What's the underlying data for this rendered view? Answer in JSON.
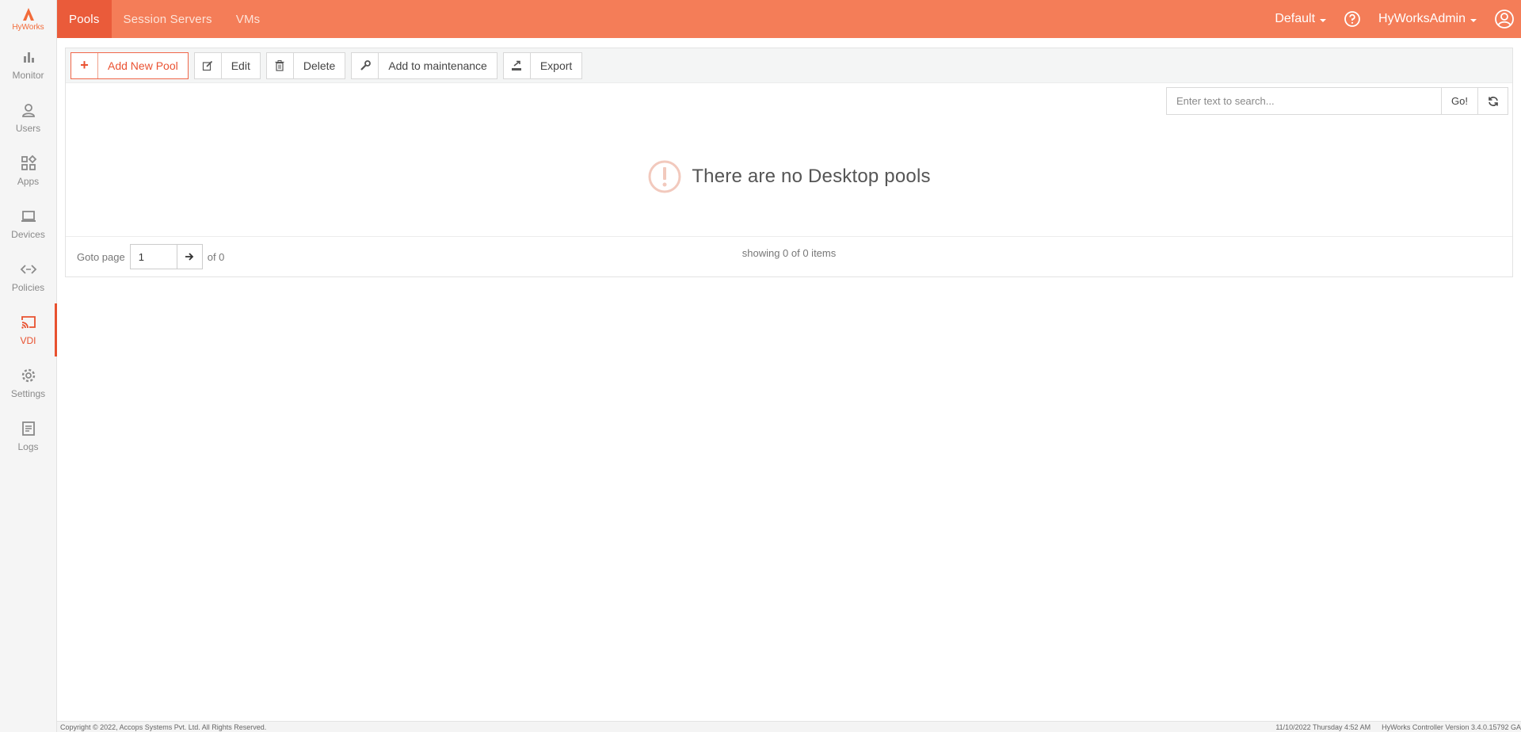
{
  "app": {
    "logo_text": "HyWorks"
  },
  "sidebar": {
    "items": [
      {
        "label": "Monitor",
        "icon": "bar-chart-icon"
      },
      {
        "label": "Users",
        "icon": "user-icon"
      },
      {
        "label": "Apps",
        "icon": "apps-grid-icon"
      },
      {
        "label": "Devices",
        "icon": "laptop-icon"
      },
      {
        "label": "Policies",
        "icon": "code-arrows-icon"
      },
      {
        "label": "VDI",
        "icon": "cast-icon",
        "active": true
      },
      {
        "label": "Settings",
        "icon": "gear-icon"
      },
      {
        "label": "Logs",
        "icon": "document-list-icon"
      }
    ]
  },
  "topbar": {
    "tabs": [
      {
        "label": "Pools",
        "active": true
      },
      {
        "label": "Session Servers"
      },
      {
        "label": "VMs"
      }
    ],
    "org_label": "Default",
    "user_label": "HyWorksAdmin"
  },
  "toolbar": {
    "add_label": "Add New Pool",
    "edit_label": "Edit",
    "delete_label": "Delete",
    "maintenance_label": "Add to maintenance",
    "export_label": "Export"
  },
  "search": {
    "placeholder": "Enter text to search...",
    "go_label": "Go!"
  },
  "empty_message": "There are no Desktop pools",
  "pager": {
    "goto_label": "Goto page",
    "page_value": "1",
    "of_label": "of 0",
    "showing_label": "showing 0 of 0 items"
  },
  "footer": {
    "copyright": "Copyright © 2022, Accops Systems Pvt. Ltd. All Rights Reserved.",
    "datetime": "11/10/2022 Thursday 4:52 AM",
    "version": "HyWorks Controller Version 3.4.0.15792 GA"
  },
  "colors": {
    "accent": "#f47d58",
    "accent_dark": "#ea5b3a",
    "sidebar_bg": "#f5f5f5"
  }
}
